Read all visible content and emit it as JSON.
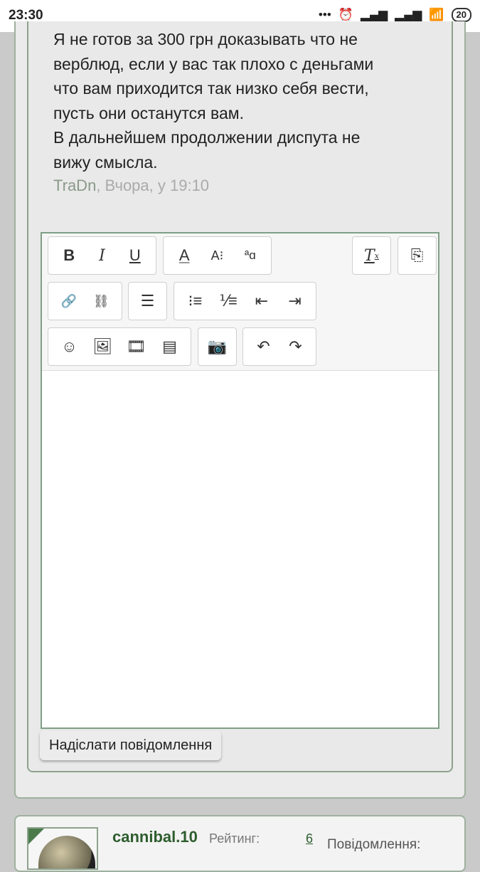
{
  "status_bar": {
    "time": "23:30",
    "battery": "20"
  },
  "post": {
    "lines": [
      "Я не готов за 300 грн доказывать что не",
      "верблюд, если у вас так плохо с деньгами",
      "что вам приходится так низко себя вести,",
      "пусть они останутся вам.",
      "В дальнейшем продолжении диспута не",
      "вижу смысла."
    ],
    "author": "TraDn",
    "date": ", Вчора, у 19:10"
  },
  "editor": {
    "send_label": "Надіслати повідомлення"
  },
  "next_post": {
    "username": "cannibal.10",
    "rating_label": "Рейтинг:",
    "rating_value": "6",
    "messages_label": "Повідомлення:"
  }
}
